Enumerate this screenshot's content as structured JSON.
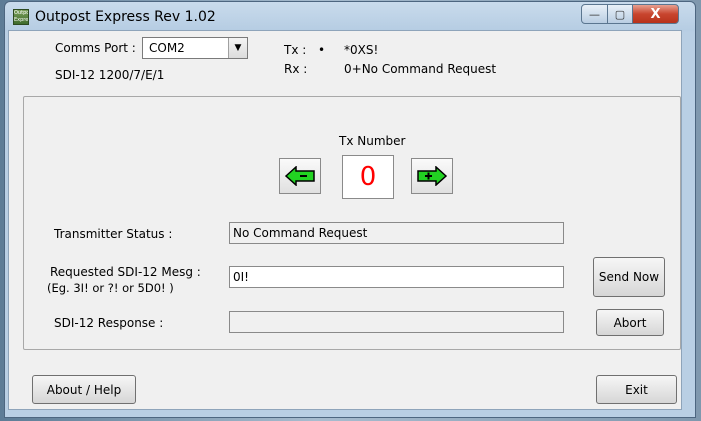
{
  "window": {
    "title": "Outpost Express  Rev 1.02",
    "app_icon_text": "Outpost Express",
    "controls": {
      "minimize": "—",
      "maximize": "▢",
      "close": "X"
    }
  },
  "comms": {
    "port_label": "Comms Port :",
    "port_value": "COM2",
    "settings_label": "SDI-12   1200/7/E/1",
    "tx_label": "Tx :",
    "tx_bullet": "•",
    "tx_value": "*0XS!",
    "rx_label": "Rx :",
    "rx_value": "0+No Command Request"
  },
  "transmitter": {
    "tx_number_label": "Tx Number",
    "tx_number": "0",
    "status_label": "Transmitter Status :",
    "status_value": "No Command Request",
    "request_label_1": "Requested SDI-12 Mesg :",
    "request_label_2": "(Eg. 3I!  or  ?!  or  5D0! )",
    "request_value": "0I!",
    "response_label": "SDI-12 Response :",
    "response_value": ""
  },
  "buttons": {
    "send_now": "Send Now",
    "abort": "Abort",
    "about_help": "About / Help",
    "exit": "Exit"
  },
  "colors": {
    "arrow_green": "#22d322",
    "number_red": "#ff0000"
  }
}
